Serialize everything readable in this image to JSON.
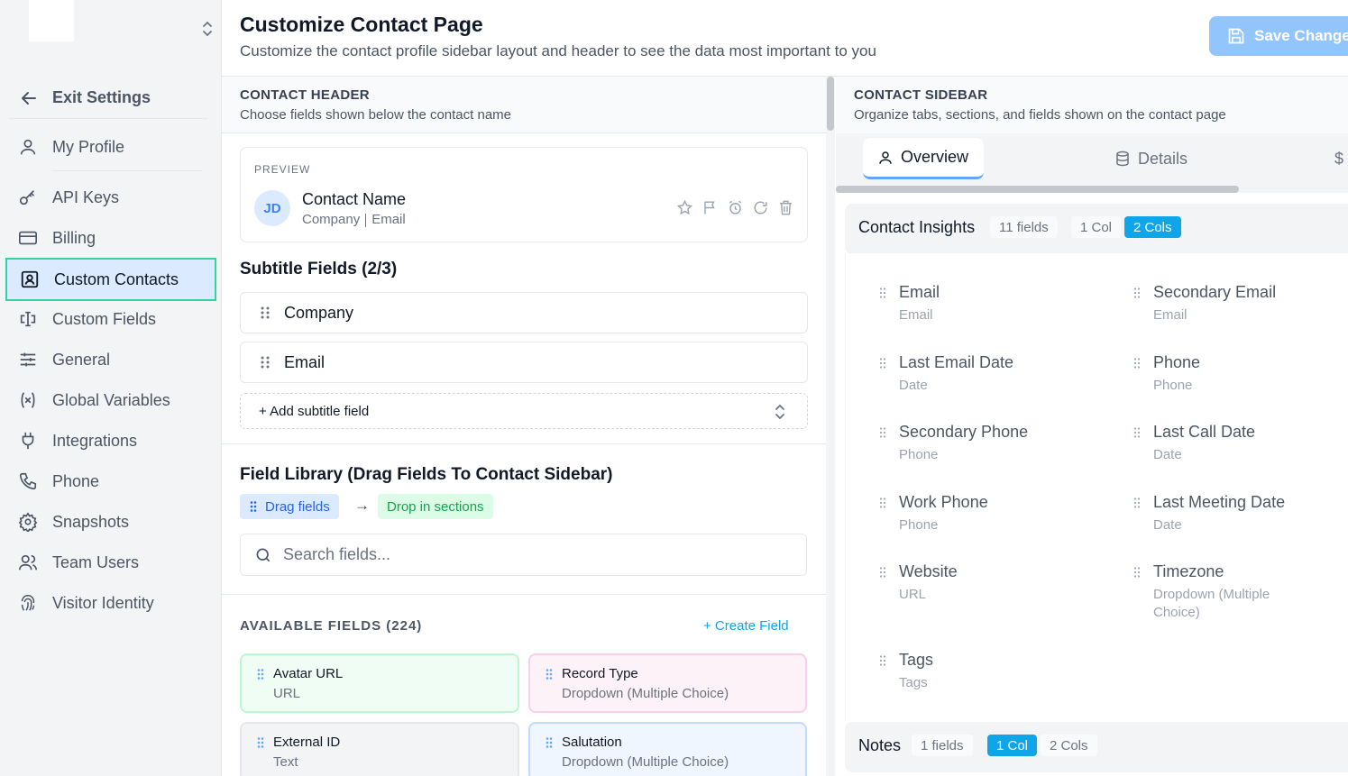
{
  "sidebar": {
    "exit_label": "Exit Settings",
    "items": [
      {
        "label": "My Profile",
        "icon": "user-icon"
      },
      {
        "label": "API Keys",
        "icon": "key-icon"
      },
      {
        "label": "Billing",
        "icon": "credit-card-icon"
      },
      {
        "label": "Custom Contacts",
        "icon": "contact-card-icon",
        "active": true
      },
      {
        "label": "Custom Fields",
        "icon": "text-cursor-input-icon"
      },
      {
        "label": "General",
        "icon": "sliders-icon"
      },
      {
        "label": "Global Variables",
        "icon": "variable-icon"
      },
      {
        "label": "Integrations",
        "icon": "plug-icon"
      },
      {
        "label": "Phone",
        "icon": "phone-icon"
      },
      {
        "label": "Snapshots",
        "icon": "gear-icon"
      },
      {
        "label": "Team Users",
        "icon": "users-icon"
      },
      {
        "label": "Visitor Identity",
        "icon": "fingerprint-icon"
      }
    ]
  },
  "header": {
    "title": "Customize Contact Page",
    "subtitle": "Customize the contact profile sidebar layout and header to see the data most important to you",
    "save_label": "Save Changes"
  },
  "contact_header": {
    "title": "CONTACT HEADER",
    "description": "Choose fields shown below the contact name",
    "preview_label": "PREVIEW",
    "avatar_initials": "JD",
    "contact_name": "Contact Name",
    "subtitle_company": "Company",
    "subtitle_email": "Email",
    "subtitle_fields_title": "Subtitle Fields (2/3)",
    "subtitle_fields": [
      "Company",
      "Email"
    ],
    "add_subtitle_label": "+ Add subtitle field"
  },
  "field_library": {
    "title": "Field Library (Drag Fields To Contact Sidebar)",
    "drag_chip": "Drag fields",
    "arrow": "→",
    "drop_chip": "Drop in sections",
    "search_placeholder": "Search fields...",
    "available_title": "AVAILABLE FIELDS (224)",
    "create_label": "+ Create Field",
    "cards": [
      {
        "name": "Avatar URL",
        "type": "URL"
      },
      {
        "name": "Record Type",
        "type": "Dropdown (Multiple Choice)"
      },
      {
        "name": "External ID",
        "type": "Text"
      },
      {
        "name": "Salutation",
        "type": "Dropdown (Multiple Choice)"
      }
    ]
  },
  "contact_sidebar": {
    "title": "CONTACT SIDEBAR",
    "description": "Organize tabs, sections, and fields shown on the contact page",
    "tabs": [
      {
        "label": "Overview",
        "icon": "user-icon"
      },
      {
        "label": "Details",
        "icon": "database-icon"
      },
      {
        "label": "$",
        "icon": "dollar-icon"
      }
    ],
    "groups": [
      {
        "title": "Contact Insights",
        "count": "11 fields",
        "one_col": "1 Col",
        "two_cols": "2 Cols",
        "layout": "2 Cols",
        "fields": [
          {
            "name": "Email",
            "type": "Email"
          },
          {
            "name": "Secondary Email",
            "type": "Email"
          },
          {
            "name": "Last Email Date",
            "type": "Date"
          },
          {
            "name": "Phone",
            "type": "Phone"
          },
          {
            "name": "Secondary Phone",
            "type": "Phone"
          },
          {
            "name": "Last Call Date",
            "type": "Date"
          },
          {
            "name": "Work Phone",
            "type": "Phone"
          },
          {
            "name": "Last Meeting Date",
            "type": "Date"
          },
          {
            "name": "Website",
            "type": "URL"
          },
          {
            "name": "Timezone",
            "type": "Dropdown (Multiple Choice)"
          },
          {
            "name": "Tags",
            "type": "Tags"
          }
        ]
      },
      {
        "title": "Notes",
        "count": "1 fields",
        "one_col": "1 Col",
        "two_cols": "2 Cols",
        "layout": "1 Col"
      }
    ]
  }
}
